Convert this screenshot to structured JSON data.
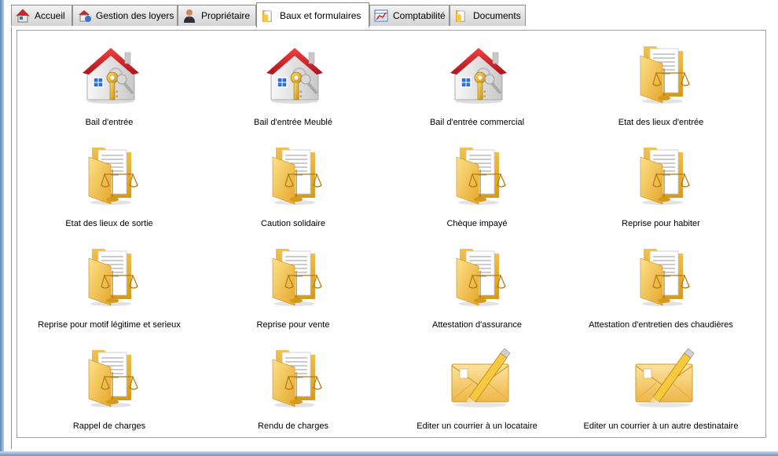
{
  "tabs": [
    {
      "label": "Accueil",
      "icon": "home-icon",
      "active": false
    },
    {
      "label": "Gestion des loyers",
      "icon": "rent-management-icon",
      "active": false
    },
    {
      "label": "Propriétaire",
      "icon": "owner-icon",
      "active": false
    },
    {
      "label": "Baux et formulaires",
      "icon": "leases-folder-icon",
      "active": true
    },
    {
      "label": "Comptabilité",
      "icon": "accounting-icon",
      "active": false
    },
    {
      "label": "Documents",
      "icon": "documents-folder-icon",
      "active": false
    }
  ],
  "items": [
    {
      "label": "Bail d'entrée",
      "icon": "house-keys-icon"
    },
    {
      "label": "Bail d'entrée Meublé",
      "icon": "house-keys-icon"
    },
    {
      "label": "Bail d'entrée commercial",
      "icon": "house-keys-icon"
    },
    {
      "label": "Etat des lieux d'entrée",
      "icon": "legal-folder-icon"
    },
    {
      "label": "Etat des lieux de sortie",
      "icon": "legal-folder-icon"
    },
    {
      "label": "Caution solidaire",
      "icon": "legal-folder-icon"
    },
    {
      "label": "Chèque impayé",
      "icon": "legal-folder-icon"
    },
    {
      "label": "Reprise pour habiter",
      "icon": "legal-folder-icon"
    },
    {
      "label": "Reprise pour motif légitime et serieux",
      "icon": "legal-folder-icon"
    },
    {
      "label": "Reprise pour vente",
      "icon": "legal-folder-icon"
    },
    {
      "label": "Attestation d'assurance",
      "icon": "legal-folder-icon"
    },
    {
      "label": "Attestation d'entretien des chaudières",
      "icon": "legal-folder-icon"
    },
    {
      "label": "Rappel de charges",
      "icon": "legal-folder-icon"
    },
    {
      "label": "Rendu de charges",
      "icon": "legal-folder-icon"
    },
    {
      "label": "Editer un courrier à un locataire",
      "icon": "envelope-pencil-icon"
    },
    {
      "label": "Editer un courrier à un autre destinataire",
      "icon": "envelope-pencil-icon"
    }
  ],
  "colors": {
    "house_roof": "#d8202a",
    "folder": "#f2c24c",
    "envelope": "#f5c65a",
    "tab_border": "#8e8f8f"
  }
}
